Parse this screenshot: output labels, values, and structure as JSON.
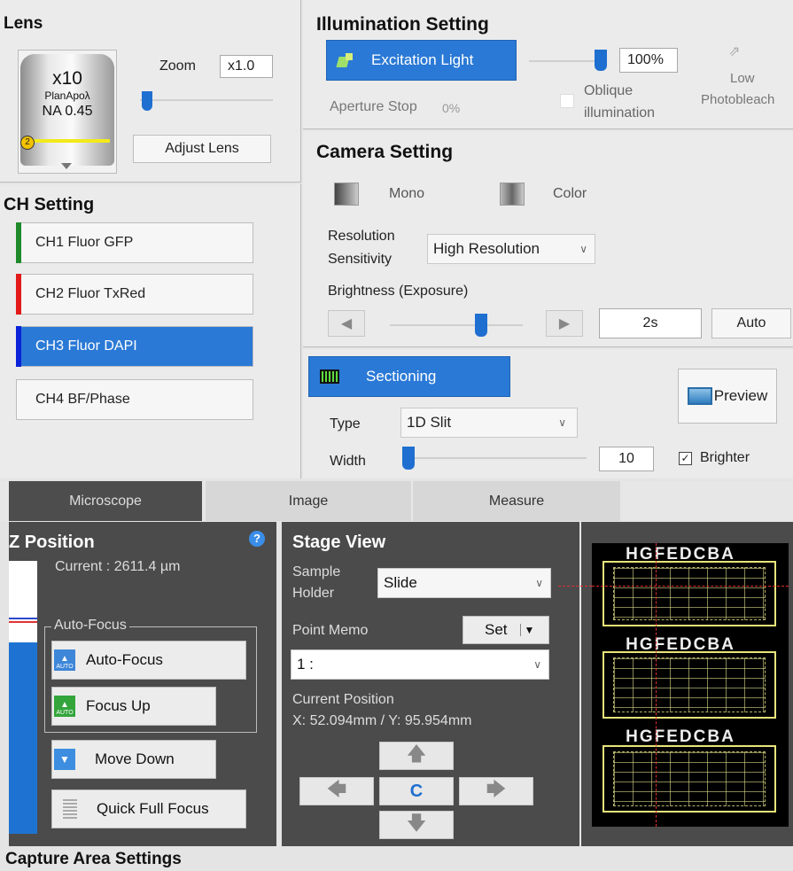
{
  "lens": {
    "title": "Lens",
    "magnification": "x10",
    "type": "PlanApoλ",
    "na": "NA 0.45",
    "badge": "2",
    "zoom_label": "Zoom",
    "zoom_value": "x1.0",
    "zoom_level": 0.05,
    "adjust_label": "Adjust Lens"
  },
  "illumination": {
    "title": "Illumination Setting",
    "excitation_label": "Excitation Light",
    "intensity_value": "100%",
    "intensity_level": 1.0,
    "aperture_label": "Aperture Stop",
    "aperture_value": "0%",
    "oblique_label_1": "Oblique",
    "oblique_label_2": "illumination",
    "low_label": "Low",
    "photobleach_label": "Photobleach"
  },
  "ch": {
    "title": "CH Setting",
    "channels": [
      {
        "label": "CH1 Fluor GFP",
        "color": "#1f8a2a",
        "selected": false
      },
      {
        "label": "CH2 Fluor TxRed",
        "color": "#e21a1a",
        "selected": false
      },
      {
        "label": "CH3 Fluor DAPI",
        "color": "#0a22d8",
        "selected": true
      },
      {
        "label": "CH4 BF/Phase",
        "color": "",
        "selected": false
      }
    ]
  },
  "camera": {
    "title": "Camera Setting",
    "mono_label": "Mono",
    "color_label": "Color",
    "resolution_label_1": "Resolution",
    "resolution_label_2": "Sensitivity",
    "resolution_value": "High Resolution",
    "brightness_label": "Brightness (Exposure)",
    "exposure_value": "2s",
    "exposure_level": 0.55,
    "auto_label": "Auto"
  },
  "sectioning": {
    "label": "Sectioning",
    "type_label": "Type",
    "type_value": "1D Slit",
    "width_label": "Width",
    "width_value": "10",
    "preview_label": "Preview",
    "brighter_label": "Brighter",
    "brighter_checked": true
  },
  "tabs": [
    "Microscope",
    "Image",
    "Measure"
  ],
  "zpos": {
    "title": "Z Position",
    "help": "?",
    "current_label": "Current : 2611.4 µm",
    "autofocus_group": "Auto-Focus",
    "autofocus_label": "Auto-Focus",
    "focusup_label": "Focus Up",
    "movedown_label": "Move Down",
    "quickfull_label": "Quick Full Focus",
    "icon_auto_text": "AUTO"
  },
  "stage": {
    "title": "Stage View",
    "holder_label_1": "Sample",
    "holder_label_2": "Holder",
    "holder_value": "Slide",
    "memo_label": "Point Memo",
    "set_label": "Set",
    "memo_value": "1 :",
    "current_pos_label": "Current Position",
    "current_pos_value": "X: 52.094mm / Y: 95.954mm",
    "center_label": "C",
    "plate_letters": "HGFEDCBA"
  },
  "capture": {
    "title": "Capture Area Settings"
  },
  "colors": {
    "accent_blue": "#2a79d6",
    "dark_panel": "#4b4b4b",
    "slide_border": "#e8e47a"
  }
}
